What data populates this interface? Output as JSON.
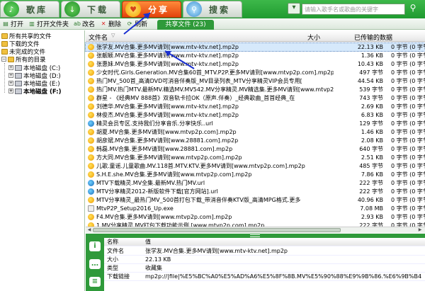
{
  "tabs": [
    {
      "label": "歌库",
      "icon": "music-library-icon"
    },
    {
      "label": "下载",
      "icon": "download-icon"
    },
    {
      "label": "分享",
      "icon": "share-icon"
    },
    {
      "label": "搜索",
      "icon": "search-icon"
    }
  ],
  "search": {
    "placeholder": "请输入歌手名或歌曲的关键字"
  },
  "toolbar": {
    "open": "打开",
    "open_folder": "打开文件夹",
    "rename": "改名",
    "delete": "删除",
    "refresh": "刷新"
  },
  "share_tab": {
    "label": "共享文件 (23)"
  },
  "tree": {
    "all_shared": "所有共享的文件",
    "downloaded": "下载的文件",
    "incomplete": "未完成的文件",
    "all_dirs": "所有的目录",
    "drives": [
      "本地磁盘 (C:)",
      "本地磁盘 (D:)",
      "本地磁盘 (E:)",
      "本地磁盘 (F:)"
    ]
  },
  "columns": {
    "name": "文件名",
    "size": "大小",
    "shared": "已传输的数据"
  },
  "files": [
    {
      "name": "张学友.MV合集.更多MV请到[www.mtv-ktv.net].mp2p",
      "size": "22.13 KB",
      "shared": "0 字节 (0 字节)",
      "icon": "fav"
    },
    {
      "name": "张靓颖.MV合集.更多MV请到[www.mtv-ktv.net].mp2p",
      "size": "1.36 KB",
      "shared": "0 字节 (0 字节)",
      "icon": "fav"
    },
    {
      "name": "张惠妹.MV合集.更多MV请到[www.mtv-ktv.net].mp2p",
      "size": "10.43 KB",
      "shared": "0 字节 (0 字节)",
      "icon": "fav"
    },
    {
      "name": "少女时代.Girls.Generation.MV合集60首_MTV.P2P.更多MV请到[www.mtvp2p.com].mp2p",
      "size": "497 字节",
      "shared": "0 字节 (0 字节)",
      "icon": "fav"
    },
    {
      "name": "热门MV_500首_高清DVD可消音伴奏版_MV目录列表_MTV分享精灵VIP会员专用[",
      "size": "44.54 KB",
      "shared": "0 字节 (0 字节)",
      "icon": "fav"
    },
    {
      "name": "热门MV.热门MTV.最新MV.精选MV.MV542.MV分享精灵.MV精选集.更多MV请到[www.mtvp2p",
      "size": "539 字节",
      "shared": "0 字节 (0 字节)",
      "icon": "fav"
    },
    {
      "name": "群星 - 《经典MV 888首》双音轨卡拉OK（原声.伴奏）_经典歌曲_首首经典_在",
      "size": "743 字节",
      "shared": "0 字节 (0 字节)",
      "icon": "fav"
    },
    {
      "name": "刘德华.MV合集.更多MV请到[www.mtv-ktv.net].mp2p",
      "size": "2.69 KB",
      "shared": "0 字节 (0 字节)",
      "icon": "fav"
    },
    {
      "name": "林俊杰.MV合集.更多MV请到[www.mtv-ktv.net].mp2p",
      "size": "6.83 KB",
      "shared": "0 字节 (0 字节)",
      "icon": "fav"
    },
    {
      "name": "精灵会员专区.支持我们分享音乐.分享快乐..url",
      "size": "129 字节",
      "shared": "0 字节 (0 字节)",
      "icon": "mv"
    },
    {
      "name": "胡夏.MV合集.更多MV请到[www.mtvp2p.com].mp2p",
      "size": "1.46 KB",
      "shared": "0 字节 (0 字节)",
      "icon": "fav"
    },
    {
      "name": "胡彦斌.MV合集.更多MV请到[www.28881.com].mp2p",
      "size": "2.08 KB",
      "shared": "0 字节 (0 字节)",
      "icon": "fav"
    },
    {
      "name": "韩磊.MV合集.更多MV请到[www.28881.com].mp2p",
      "size": "640 字节",
      "shared": "0 字节 (0 字节)",
      "icon": "fav"
    },
    {
      "name": "方大同.MV合集.更多MV请到[www.mtvp2p.com].mp2p",
      "size": "2.51 KB",
      "shared": "0 字节 (0 字节)",
      "icon": "fav"
    },
    {
      "name": "儿歌.童谣.儿童歌曲.MV.118首.MTV.KTV.更多MV请到[www.mtvp2p.com].mp2p",
      "size": "485 字节",
      "shared": "0 字节 (0 字节)",
      "icon": "fav"
    },
    {
      "name": "S.H.E.she.MV合集.更多MV请到[www.mtvp2p.com].mp2p",
      "size": "7.86 KB",
      "shared": "0 字节 (0 字节)",
      "icon": "fav"
    },
    {
      "name": "MTV下载精灵.MV全集.最新MV.热门MV.url",
      "size": "222 字节",
      "shared": "0 字节 (0 字节)",
      "icon": "mv"
    },
    {
      "name": "MTV分享精灵2012-新版软件下载[官方网站].url",
      "size": "222 字节",
      "shared": "0 字节 (0 字节)",
      "icon": "mv"
    },
    {
      "name": "MTV分享精灵_最热门MV_500首打包下载_带消音伴奏KTV版_高清MPG格式.更多",
      "size": "40.96 KB",
      "shared": "0 字节 (0 字节)",
      "icon": "fav"
    },
    {
      "name": "MtvP2P_Setup2016_Up.exe",
      "size": "7.08 MB",
      "shared": "0 字节 (0 字节)",
      "icon": "doc"
    },
    {
      "name": "F4.MV合集.更多MV请到[www.mtvp2p.com].mp2p",
      "size": "2.93 KB",
      "shared": "0 字节 (0 字节)",
      "icon": "fav"
    },
    {
      "name": "1.MV分享精灵.MV打包下载功能示例.[www.mtvp2p.com].mp2p",
      "size": "222 字节",
      "shared": "0 字节 (0 字节)",
      "icon": "fav"
    }
  ],
  "detail": {
    "header": {
      "k": "名称",
      "v": "值"
    },
    "rows": [
      {
        "k": "文件名",
        "v": "张学友.MV合集.更多MV请到[www.mtv-ktv.net].mp2p"
      },
      {
        "k": "大小",
        "v": "22.13 KB"
      },
      {
        "k": "类型",
        "v": "收藏集"
      },
      {
        "k": "下载链接",
        "v": "mp2p://|file|%E5%BC%A0%E5%AD%A6%E5%8F%8B.MV%E5%90%88%E9%9B%86.%E6%9B%B4%E5%A4%9A"
      }
    ]
  },
  "colors": {
    "green": "#2f9a3a",
    "share_tab": "#e3430c",
    "arrow": "#1a2fd0"
  }
}
